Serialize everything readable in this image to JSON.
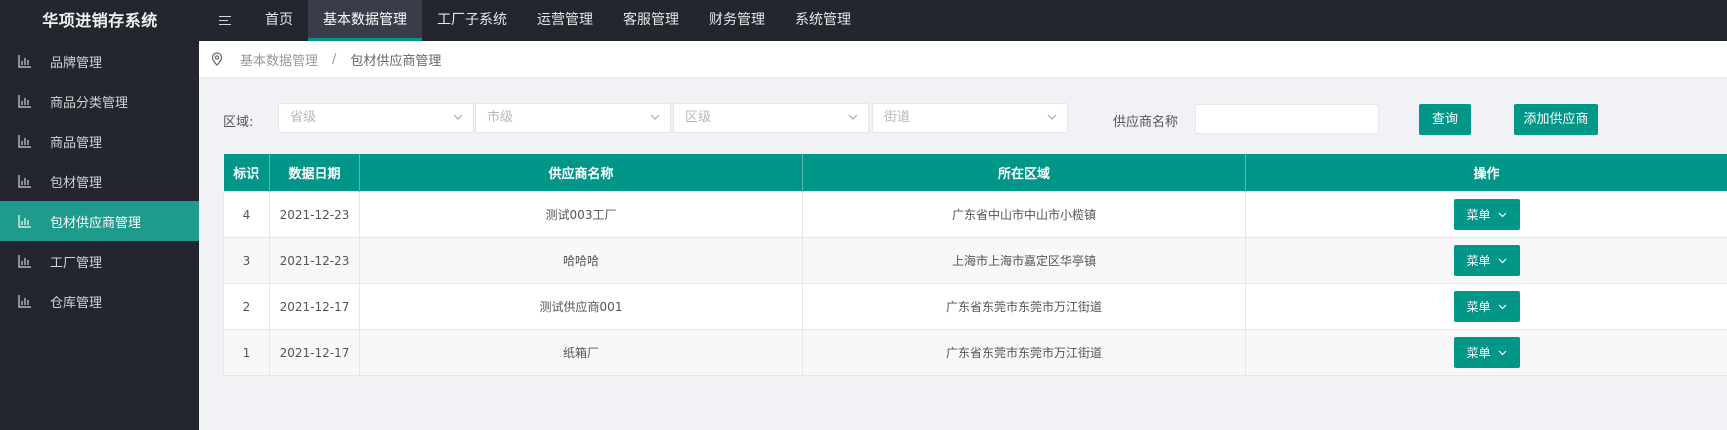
{
  "app": {
    "title": "华项进销存系统"
  },
  "topnav": {
    "items": [
      {
        "label": "首页"
      },
      {
        "label": "基本数据管理",
        "active": true
      },
      {
        "label": "工厂子系统"
      },
      {
        "label": "运营管理"
      },
      {
        "label": "客服管理"
      },
      {
        "label": "财务管理"
      },
      {
        "label": "系统管理"
      }
    ]
  },
  "sidebar": {
    "items": [
      {
        "label": "品牌管理"
      },
      {
        "label": "商品分类管理"
      },
      {
        "label": "商品管理"
      },
      {
        "label": "包材管理"
      },
      {
        "label": "包材供应商管理",
        "active": true
      },
      {
        "label": "工厂管理"
      },
      {
        "label": "仓库管理"
      }
    ]
  },
  "breadcrumb": {
    "parent": "基本数据管理",
    "separator": "/",
    "current": "包材供应商管理"
  },
  "filters": {
    "region_label": "区域:",
    "province_placeholder": "省级",
    "city_placeholder": "市级",
    "district_placeholder": "区级",
    "street_placeholder": "街道",
    "supplier_name_label": "供应商名称",
    "supplier_name_value": "",
    "search_label": "查询",
    "add_label": "添加供应商"
  },
  "table": {
    "headers": [
      "标识",
      "数据日期",
      "供应商名称",
      "所在区域",
      "操作"
    ],
    "rows": [
      {
        "id": "4",
        "date": "2021-12-23",
        "name": "测试003工厂",
        "region": "广东省中山市中山市小榄镇",
        "action": "菜单"
      },
      {
        "id": "3",
        "date": "2021-12-23",
        "name": "哈哈哈",
        "region": "上海市上海市嘉定区华亭镇",
        "action": "菜单"
      },
      {
        "id": "2",
        "date": "2021-12-17",
        "name": "测试供应商001",
        "region": "广东省东莞市东莞市万江街道",
        "action": "菜单"
      },
      {
        "id": "1",
        "date": "2021-12-17",
        "name": "纸箱厂",
        "region": "广东省东莞市东莞市万江街道",
        "action": "菜单"
      }
    ]
  },
  "colors": {
    "accent": "#009688",
    "sidebar_bg": "#23262e",
    "active_nav_bg": "#393d49"
  },
  "icons": {
    "menu_toggle": "menu-icon",
    "sidebar_item": "chart-icon",
    "breadcrumb": "location-pin-icon",
    "select": "chevron-down-icon"
  }
}
